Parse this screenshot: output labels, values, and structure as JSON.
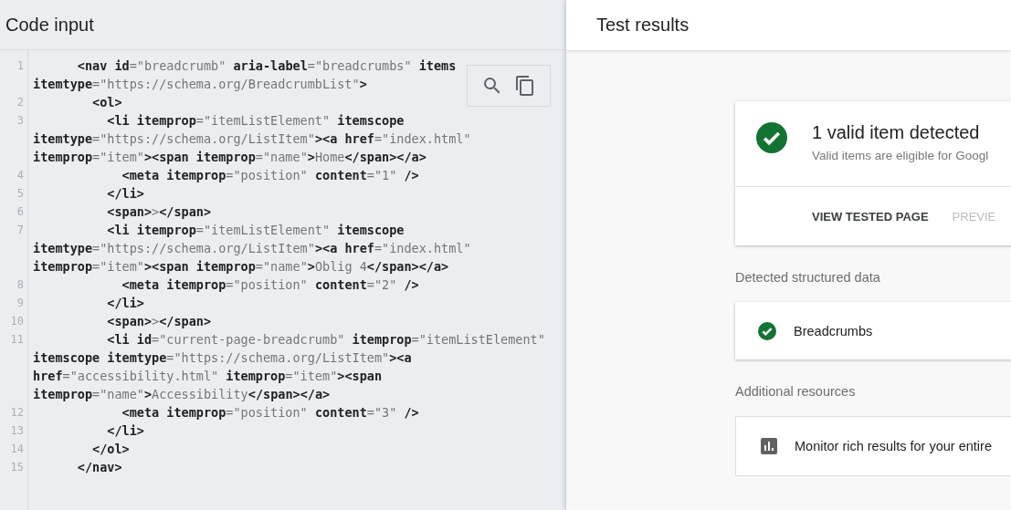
{
  "code_panel": {
    "title": "Code input",
    "lines": [
      {
        "number": "1",
        "rows": [
          "      **<nav id**=\"breadcrumb\" **aria-label**=\"breadcrumbs\" **items**",
          "**itemtype**=\"https://schema.org/BreadcrumbList\"**>**"
        ]
      },
      {
        "number": "2",
        "rows": [
          "        **<ol>**"
        ]
      },
      {
        "number": "3",
        "rows": [
          "          **<li itemprop**=\"itemListElement\" **itemscope**",
          "**itemtype**=\"https://schema.org/ListItem\"**><a href**=\"index.html\"",
          "**itemprop**=\"item\"**><span itemprop**=\"name\"**>**Home**</span></a>**"
        ]
      },
      {
        "number": "4",
        "rows": [
          "            **<meta itemprop**=\"position\" **content**=\"1\" **/>**"
        ]
      },
      {
        "number": "5",
        "rows": [
          "          **</li>**"
        ]
      },
      {
        "number": "6",
        "rows": [
          "          **<span>**>**</span>**"
        ]
      },
      {
        "number": "7",
        "rows": [
          "          **<li itemprop**=\"itemListElement\" **itemscope**",
          "**itemtype**=\"https://schema.org/ListItem\"**><a href**=\"index.html\"",
          "**itemprop**=\"item\"**><span itemprop**=\"name\"**>**Oblig 4**</span></a>**"
        ]
      },
      {
        "number": "8",
        "rows": [
          "            **<meta itemprop**=\"position\" **content**=\"2\" **/>**"
        ]
      },
      {
        "number": "9",
        "rows": [
          "          **</li>**"
        ]
      },
      {
        "number": "10",
        "rows": [
          "          **<span>**>**</span>**"
        ]
      },
      {
        "number": "11",
        "rows": [
          "          **<li id**=\"current-page-breadcrumb\" **itemprop**=\"itemListElement\"",
          "**itemscope itemtype**=\"https://schema.org/ListItem\"**><a**",
          "**href**=\"accessibility.html\" **itemprop**=\"item\"**><span**",
          "**itemprop**=\"name\"**>**Accessibility**</span></a>**"
        ]
      },
      {
        "number": "12",
        "rows": [
          "            **<meta itemprop**=\"position\" **content**=\"3\" **/>**"
        ]
      },
      {
        "number": "13",
        "rows": [
          "          **</li>**"
        ]
      },
      {
        "number": "14",
        "rows": [
          "        **</ol>**"
        ]
      },
      {
        "number": "15",
        "rows": [
          "      **</nav>**"
        ]
      }
    ]
  },
  "results_panel": {
    "title": "Test results",
    "summary": {
      "title": "1 valid item detected",
      "subtitle": "Valid items are eligible for Googl",
      "actions": [
        {
          "label": "VIEW TESTED PAGE",
          "disabled": false
        },
        {
          "label": "PREVIE",
          "disabled": true
        }
      ]
    },
    "detected_heading": "Detected structured data",
    "detected_items": [
      {
        "name": "Breadcrumbs",
        "valid": true
      }
    ],
    "resources_heading": "Additional resources",
    "resources": [
      {
        "label": "Monitor rich results for your entire"
      }
    ]
  }
}
